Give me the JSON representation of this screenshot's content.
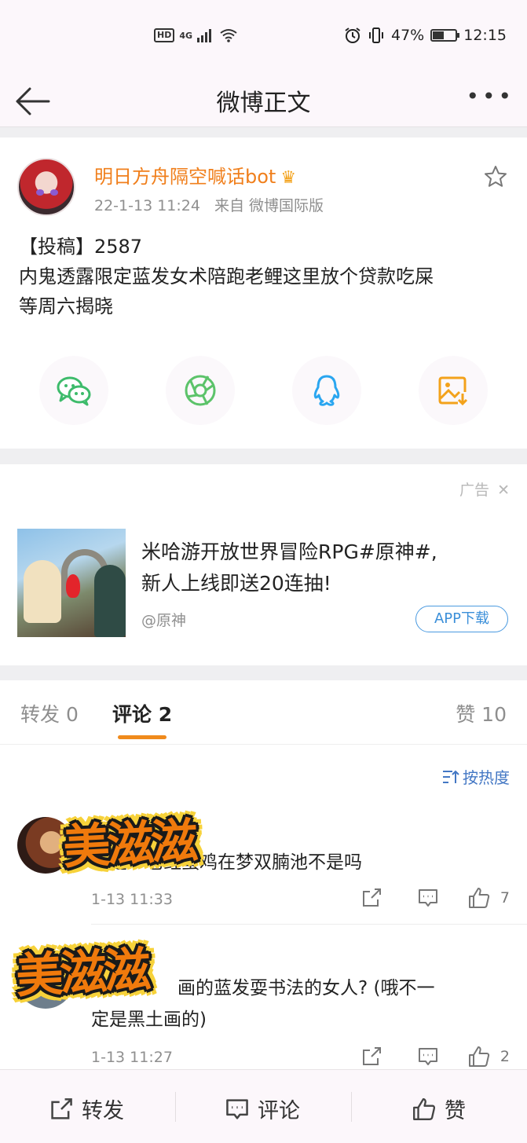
{
  "status_bar": {
    "network": "HD",
    "signal_type": "4G",
    "battery_percent": "47%",
    "battery_level": 0.47,
    "time": "12:15"
  },
  "nav": {
    "title": "微博正文"
  },
  "post": {
    "author": "明日方舟隔空喊话bot",
    "date": "22-1-13 11:24",
    "source": "来自 微博国际版",
    "text_line1": "【投稿】2587",
    "text_line2": "内鬼透露限定蓝发女术陪跑老鲤这里放个贷款吃屎",
    "text_line3": "等周六揭晓"
  },
  "ad": {
    "label": "广告",
    "title_line1": "米哈游开放世界冒险RPG#原神#,",
    "title_line2": "新人上线即送20连抽!",
    "source": "@原神",
    "button": "APP下载"
  },
  "tabs": {
    "repost": "转发 0",
    "comment": "评论 2",
    "like": "赞 10"
  },
  "sort_label": "按热度",
  "comments": [
    {
      "text": "但是一老鲤蛋鸡在梦双腩池不是吗",
      "time": "1-13 11:33",
      "likes": "7"
    },
    {
      "text_line1": "画的蓝发耍书法的女人? (哦不一",
      "text_line2": "定是黑土画的)",
      "time": "1-13 11:27",
      "likes": "2"
    }
  ],
  "sticker_text": "美滋滋",
  "bottom_bar": {
    "repost": "转发",
    "comment": "评论",
    "like": "赞"
  },
  "colors": {
    "accent_orange": "#f07f1c",
    "link_blue": "#4377c4",
    "wechat_green": "#3dbb6b",
    "moments_green": "#5cc36a",
    "qq_blue": "#2aa6f0",
    "save_orange": "#f3a21b"
  }
}
